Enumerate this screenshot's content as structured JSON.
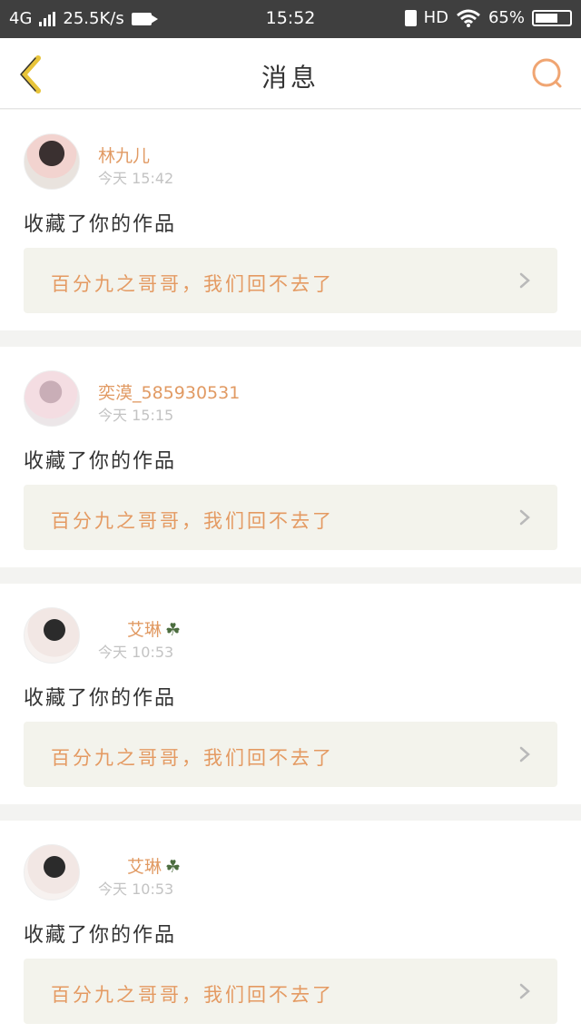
{
  "status_bar": {
    "network": "4G",
    "speed": "25.5K/s",
    "time": "15:52",
    "hd": "HD",
    "battery": "65%"
  },
  "header": {
    "back_icon": "chevron-left-icon",
    "title": "消息",
    "search_icon": "search-icon"
  },
  "messages": [
    {
      "user": "林九儿",
      "time": "今天 15:42",
      "action": "收藏了你的作品",
      "work_title": "百分九之哥哥，我们回不去了",
      "clover": false
    },
    {
      "user": "奕漠_585930531",
      "time": "今天 15:15",
      "action": "收藏了你的作品",
      "work_title": "百分九之哥哥，我们回不去了",
      "clover": false
    },
    {
      "user": "艾琳",
      "time": "今天 10:53",
      "action": "收藏了你的作品",
      "work_title": "百分九之哥哥，我们回不去了",
      "clover": true
    },
    {
      "user": "艾琳",
      "time": "今天 10:53",
      "action": "收藏了你的作品",
      "work_title": "百分九之哥哥，我们回不去了",
      "clover": true
    }
  ],
  "colors": {
    "accent": "#e49a62",
    "back_arrow": "#e8c43a",
    "search": "#f0a572",
    "card_bg": "#f3f3ec"
  }
}
